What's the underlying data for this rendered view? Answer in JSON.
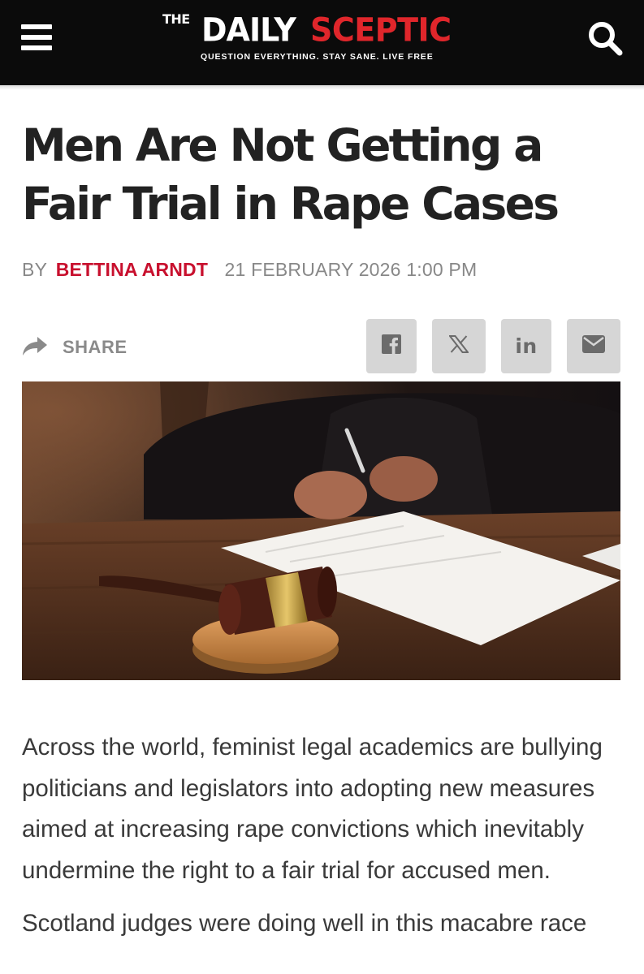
{
  "header": {
    "logo": {
      "the": "THE",
      "daily": "DAILY",
      "sceptic": "SCEPTIC"
    },
    "tagline": "QUESTION EVERYTHING. STAY SANE. LIVE FREE",
    "menu_icon": "hamburger-menu-icon",
    "search_icon": "search-icon"
  },
  "article": {
    "title": "Men Are Not Getting a Fair Trial in Rape Cases",
    "byline_prefix": "BY",
    "author": "BETTINA ARNDT",
    "date": "21 FEBRUARY 2026 1:00 PM",
    "paragraphs": [
      "Across the world, feminist legal academics are bullying politicians and legislators into adopting new measures aimed at increasing rape convictions which inevitably undermine the right to a fair trial for accused men.",
      "Scotland judges were doing well in this macabre race"
    ]
  },
  "share": {
    "label": "SHARE",
    "icon": "share-arrow-icon",
    "buttons": [
      {
        "network": "facebook",
        "icon": "facebook-icon"
      },
      {
        "network": "x",
        "icon": "x-icon"
      },
      {
        "network": "linkedin",
        "icon": "linkedin-icon",
        "glyph": "in"
      },
      {
        "network": "email",
        "icon": "email-icon"
      }
    ]
  },
  "colors": {
    "header_bg": "#0b0b0b",
    "brand_red": "#e0262b",
    "author_red": "#c8102e",
    "share_button_bg": "#d6d6d6"
  }
}
